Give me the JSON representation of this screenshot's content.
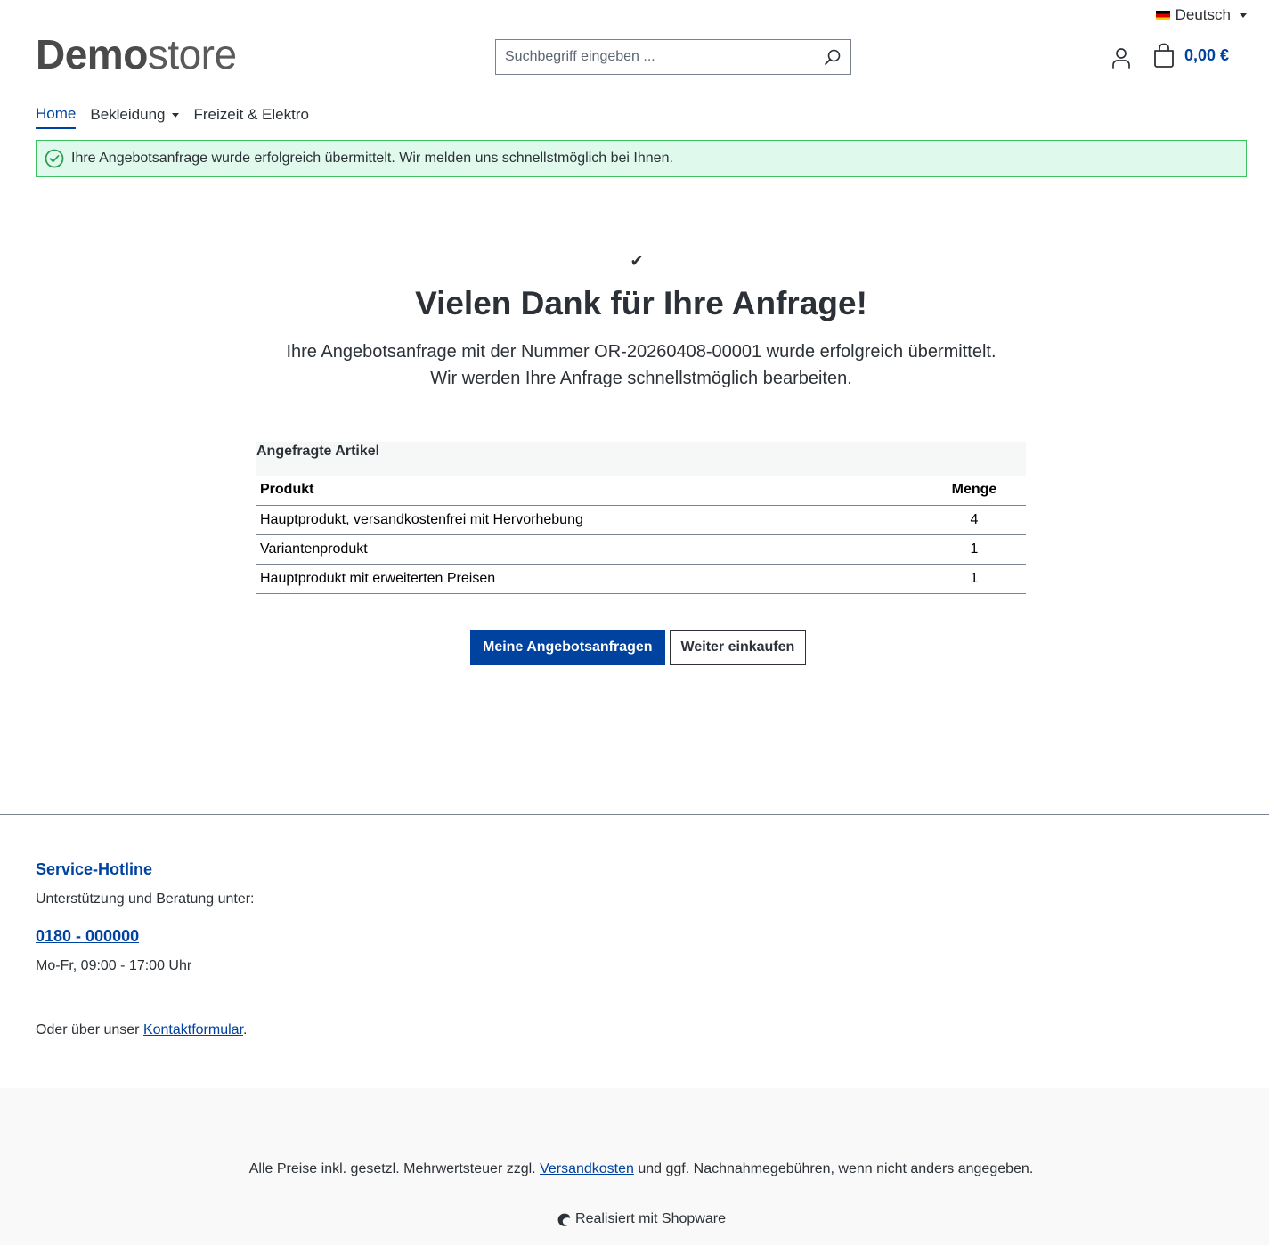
{
  "header": {
    "language": "Deutsch",
    "logo_bold": "Demo",
    "logo_light": "store",
    "search_placeholder": "Suchbegriff eingeben ...",
    "cart_total": "0,00 €"
  },
  "nav": {
    "items": [
      {
        "label": "Home",
        "active": true
      },
      {
        "label": "Bekleidung",
        "dropdown": true
      },
      {
        "label": "Freizeit & Elektro"
      }
    ]
  },
  "alert": {
    "text": "Ihre Angebotsanfrage wurde erfolgreich übermittelt. Wir melden uns schnellstmöglich bei Ihnen.",
    "color": "#3cc261"
  },
  "main": {
    "check_glyph": "✔",
    "title": "Vielen Dank für Ihre Anfrage!",
    "subtitle_line1": "Ihre Angebotsanfrage mit der Nummer OR-20260408-00001 wurde erfolgreich übermittelt.",
    "subtitle_line2": "Wir werden Ihre Anfrage schnellstmöglich bearbeiten.",
    "table": {
      "caption": "Angefragte Artikel",
      "headers": {
        "product": "Produkt",
        "qty": "Menge"
      },
      "rows": [
        {
          "product": "Hauptprodukt, versandkostenfrei mit Hervorhebung",
          "qty": "4"
        },
        {
          "product": "Variantenprodukt",
          "qty": "1"
        },
        {
          "product": "Hauptprodukt mit erweiterten Preisen",
          "qty": "1"
        }
      ]
    },
    "primary_button": "Meine Angebotsanfragen",
    "secondary_button": "Weiter einkaufen"
  },
  "footer": {
    "hotline_title": "Service-Hotline",
    "hotline_text": "Unterstützung und Beratung unter:",
    "hotline_phone": "0180 - 000000",
    "hotline_hours": "Mo-Fr, 09:00 - 17:00 Uhr",
    "contact_prefix": "Oder über unser ",
    "contact_link": "Kontaktformular",
    "contact_suffix": ".",
    "vat_prefix": "Alle Preise inkl. gesetzl. Mehrwertsteuer zzgl. ",
    "vat_link": "Versandkosten",
    "vat_suffix": " und ggf. Nachnahmegebühren, wenn nicht anders angegeben.",
    "powered_by": "Realisiert mit Shopware"
  },
  "colors": {
    "brand": "#0042a0",
    "text": "#2b3136",
    "success_bg": "#e0f9ed"
  }
}
